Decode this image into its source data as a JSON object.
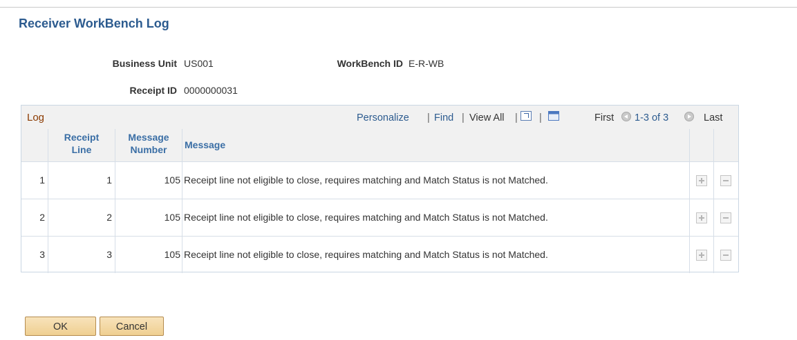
{
  "page": {
    "title": "Receiver WorkBench Log"
  },
  "header": {
    "business_unit_label": "Business Unit",
    "business_unit_value": "US001",
    "workbench_id_label": "WorkBench ID",
    "workbench_id_value": "E-R-WB",
    "receipt_id_label": "Receipt ID",
    "receipt_id_value": "0000000031"
  },
  "grid": {
    "title": "Log",
    "nav": {
      "personalize": "Personalize",
      "find": "Find",
      "view_all": "View All",
      "first": "First",
      "range": "1-3 of 3",
      "last": "Last",
      "separator": "|"
    },
    "icons": {
      "zoom": "zoom-grid-icon",
      "download": "download-excel-icon",
      "prev": "previous-circle-icon",
      "next": "next-circle-icon",
      "add_row": "add-row-icon",
      "delete_row": "delete-row-icon"
    },
    "columns": {
      "receipt_line_1": "Receipt",
      "receipt_line_2": "Line",
      "message_number_1": "Message",
      "message_number_2": "Number",
      "message": "Message"
    },
    "rows": [
      {
        "row_num": "1",
        "receipt_line": "1",
        "message_number": "105",
        "message": "Receipt line not eligible to close, requires matching and Match Status is not Matched."
      },
      {
        "row_num": "2",
        "receipt_line": "2",
        "message_number": "105",
        "message": "Receipt line not eligible to close, requires matching and Match Status is not Matched."
      },
      {
        "row_num": "3",
        "receipt_line": "3",
        "message_number": "105",
        "message": "Receipt line not eligible to close, requires matching and Match Status is not Matched."
      }
    ]
  },
  "buttons": {
    "ok": "OK",
    "cancel": "Cancel"
  },
  "colors": {
    "title": "#2c5b8f",
    "link": "#2c5b8f",
    "grid_title": "#8b3a00",
    "column_header": "#3a6ea5",
    "button_fill": "#efcf91",
    "button_border": "#b48b4e"
  }
}
